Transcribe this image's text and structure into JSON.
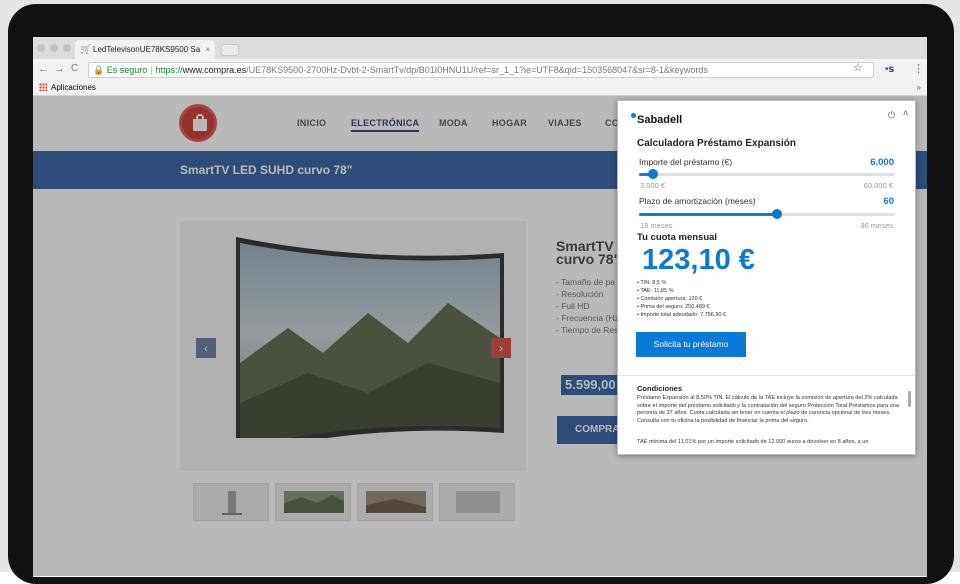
{
  "browser": {
    "tab_title": "LedTelevisonUE78KS9500 Sa",
    "tab_close": "×",
    "secure_label": "Es seguro",
    "url_scheme": "https://",
    "url_host": "www.compra.es",
    "url_path": "/UE78KS9500-2700Hz-Dvbt-2-SmartTv/dp/B01I0HNU1U/ref=sr_1_1?ie=UTF8&qid=1503568047&sr=8-1&keywords",
    "bookmarks_label": "Aplicaciones",
    "back": "←",
    "forward": "→",
    "reload": "C",
    "star": "☆",
    "ext_icon_text": "s",
    "menu": "⋮",
    "more": "»"
  },
  "site": {
    "nav": [
      "INICIO",
      "ELECTRÓNICA",
      "MODA",
      "HOGAR",
      "VIAJES",
      "CO"
    ],
    "active_nav": "ELECTRÓNICA",
    "banner_title": "SmartTV LED SUHD curvo 78\"",
    "product_title_1": "SmartTV L",
    "product_title_2": "curvo 78\"",
    "features": [
      "- Tamaño de pa",
      "- Resolución",
      "- Full HD",
      "- Frecuencia (Hz",
      "- Tiempo de Res"
    ],
    "price": "5.599,00",
    "buy_label": "COMPRA",
    "prev": "‹",
    "next": "›"
  },
  "popup": {
    "brand": "Sabadell",
    "power_icon": "⏻",
    "collapse_icon": "˄",
    "title": "Calculadora Préstamo Expansión",
    "amount_label": "Importe del préstamo (€)",
    "amount_value": "6.000",
    "amount_min": "3.000 €",
    "amount_max": "60.000 €",
    "amount_fraction": 0.053,
    "term_label": "Plazo de amortización (meses)",
    "term_value": "60",
    "term_min": "18 meses",
    "term_max": "96 meses",
    "term_fraction": 0.54,
    "monthly_label": "Tu cuota mensual",
    "monthly_value": "123,10 €",
    "details": [
      "• TIN: 8,5 %",
      "• TAE: 11,85 %",
      "• Comisión apertura: 120 €",
      "• Prima del seguro: 250,489 €",
      "• Importe total adeudado: 7.756,90 €"
    ],
    "cta_label": "Solicita tu préstamo",
    "conditions_title": "Condiciones",
    "conditions_text": "Préstamo Expansión al 8,50% TIN. El cálculo de la TAE incluye la comisión de apertura del 2% calculada sobre el importe del préstamo solicitado y la contratación del seguro Protección Total Préstamos para una persona de 37 años. Cuota calculada sin tener en cuenta el plazo de carencia opcional de tres meses. Consulta con tu oficina la posibilidad de financiar la prima del seguro.",
    "conditions_text_2": "TAE mínima del 11,01% por un importe solicitado de 12.000 euros a devolver en 8 años, a un",
    "accent_color": "#0a7ad6"
  }
}
